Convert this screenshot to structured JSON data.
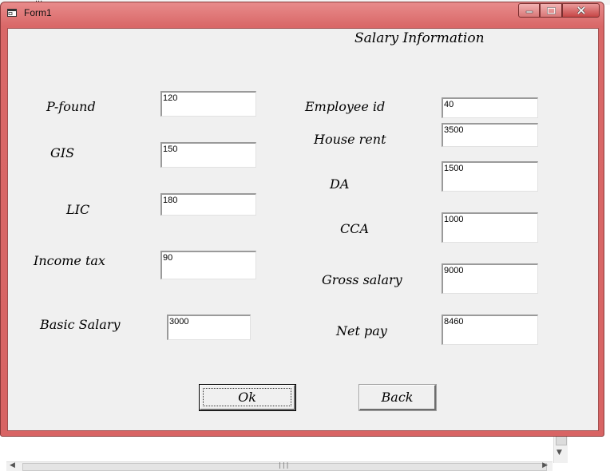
{
  "background": {
    "top_text": "...",
    "h_scroll_grip": "|||"
  },
  "window": {
    "title": "Form1",
    "colors": {
      "frame": "#d86464",
      "client": "#f0f0f0"
    }
  },
  "form": {
    "heading": "Salary  Information",
    "left_fields": [
      {
        "label": "P-found",
        "value": "120"
      },
      {
        "label": "GIS",
        "value": "150"
      },
      {
        "label": "LIC",
        "value": "180"
      },
      {
        "label": "Income tax",
        "value": "90"
      },
      {
        "label": "Basic Salary",
        "value": "3000"
      }
    ],
    "right_fields": [
      {
        "label": "Employee id",
        "value": "40"
      },
      {
        "label": "House rent",
        "value": "3500"
      },
      {
        "label": "DA",
        "value": "1500"
      },
      {
        "label": "CCA",
        "value": "1000"
      },
      {
        "label": "Gross salary",
        "value": "9000"
      },
      {
        "label": "Net pay",
        "value": "8460"
      }
    ],
    "buttons": {
      "ok": "Ok",
      "back": "Back"
    }
  }
}
